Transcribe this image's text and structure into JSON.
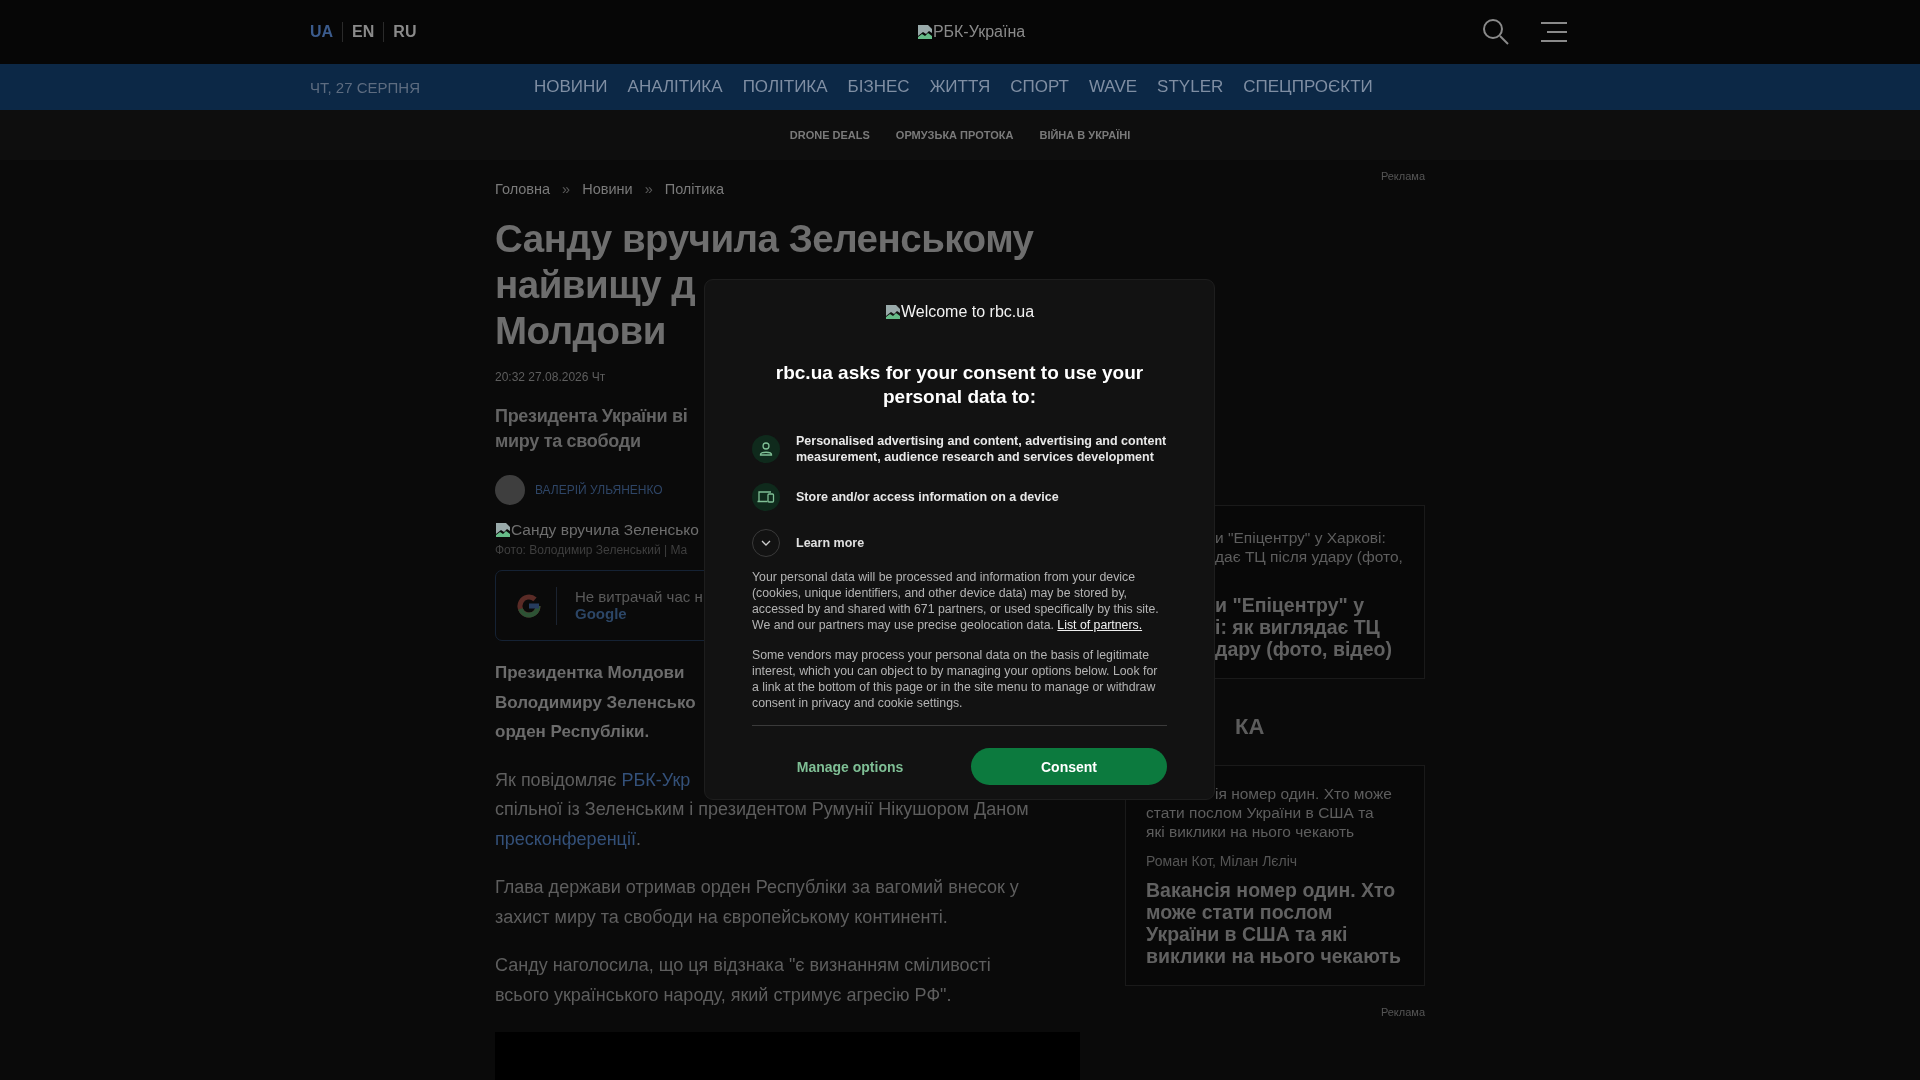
{
  "header": {
    "languages": [
      {
        "label": "UA",
        "selected": true
      },
      {
        "label": "EN",
        "selected": false
      },
      {
        "label": "RU",
        "selected": false
      }
    ],
    "logo_alt": "РБК-Україна"
  },
  "nav": {
    "date": "ЧТ, 27 СЕРПНЯ",
    "items": [
      "НОВИНИ",
      "АНАЛІТИКА",
      "ПОЛІТИКА",
      "БІЗНЕС",
      "ЖИТТЯ",
      "СПОРТ",
      "WAVE",
      "STYLER",
      "СПЕЦПРОЄКТИ"
    ]
  },
  "tags": [
    "DRONE DEALS",
    "ОРМУЗЬКА ПРОТОКА",
    "ВІЙНА В УКРАЇНІ"
  ],
  "breadcrumbs": [
    {
      "kind": "link",
      "text": "Головна"
    },
    {
      "kind": "separator",
      "text": "»"
    },
    {
      "kind": "link",
      "text": "Новини"
    },
    {
      "kind": "separator",
      "text": "»"
    },
    {
      "kind": "link",
      "text": "Політика"
    }
  ],
  "article": {
    "title_lines": [
      "Санду вручила Зеленському",
      "найвищу д",
      "Молдови"
    ],
    "datetime": "20:32 27.08.2026 Чт",
    "subtitle_lines": [
      "Президента України ві",
      "миру та свободи"
    ],
    "author": "ВАЛЕРІЙ УЛЬЯНЕНКО",
    "image_alt": "Санду вручила Зеленсько",
    "caption": "Фото: Володимир Зеленський | Ма",
    "promo_lines": [
      "Не витрачай час н",
      "Google"
    ],
    "lead_lines": [
      "Президентка Молдови",
      "Володимиру Зеленсько",
      "орден Республіки."
    ],
    "paragraphs": [
      {
        "lines": [
          [
            {
              "kind": "text",
              "text": "Як повідомляє "
            },
            {
              "kind": "link",
              "text": "РБК-Укр"
            }
          ],
          [
            {
              "kind": "text",
              "text": "спільної із Зеленським і президентом Румунії Нікушором Даном"
            }
          ],
          [
            {
              "kind": "link",
              "text": "пресконференції"
            },
            {
              "kind": "text",
              "text": "."
            }
          ]
        ]
      },
      {
        "lines": [
          [
            {
              "kind": "text",
              "text": "Глава держави отримав орден Республіки за вагомий внесок у"
            }
          ],
          [
            {
              "kind": "text",
              "text": "захист миру та свободи на європейському континенті."
            }
          ]
        ]
      },
      {
        "lines": [
          [
            {
              "kind": "text",
              "text": "Санду наголосила, що ця відзнака \"є визнанням сміливості"
            }
          ],
          [
            {
              "kind": "text",
              "text": "всього українського народу, який стримує агресію РФ\"."
            }
          ]
        ]
      }
    ]
  },
  "sidebar": {
    "ad_labels": [
      "Реклама",
      "Реклама"
    ],
    "card_1": {
      "kicker_lines": [
        "и \"Епіцентру\" у Харкові:",
        "дає ТЦ після удару (фото,"
      ],
      "title_lines": [
        "и \"Епіцентру\" у",
        "і: як виглядає ТЦ",
        "дару (фото, відео)"
      ]
    },
    "section_heading": "КА",
    "card_2": {
      "kicker_lines": [
        "ія номер один. Хто може",
        "стати послом України в США та",
        "які виклики на нього чекають"
      ],
      "author": "Роман Кот, Мілан Лєліч",
      "title_lines": [
        "Вакансія номер один. Хто",
        "може стати послом",
        "України в США та які",
        "виклики на нього чекають"
      ]
    }
  },
  "consent": {
    "logo_alt": "Welcome to rbc.ua",
    "heading": "rbc.ua asks for your consent to use your personal data to:",
    "purposes": [
      {
        "kind": "person",
        "text": "Personalised advertising and content, advertising and content measurement, audience research and services development"
      },
      {
        "kind": "device",
        "text": "Store and/or access information on a device"
      }
    ],
    "learn_more": {
      "label": "Learn more",
      "expanded": false
    },
    "paragraph_1": "Your personal data will be processed and information from your device (cookies, unique identifiers, and other device data) may be stored by, accessed by and shared with 671 partners, or used specifically by this site. We and our partners may use precise geolocation data.",
    "partners_link": "List of partners.",
    "paragraph_2": "Some vendors may process your personal data on the basis of legitimate interest, which you can object to by managing your options below. Look for a link at the bottom of this page or in the site menu to manage or withdraw consent in privacy and cookie settings.",
    "buttons": [
      {
        "kind": "secondary",
        "label": "Manage options"
      },
      {
        "kind": "primary",
        "label": "Consent"
      }
    ]
  }
}
